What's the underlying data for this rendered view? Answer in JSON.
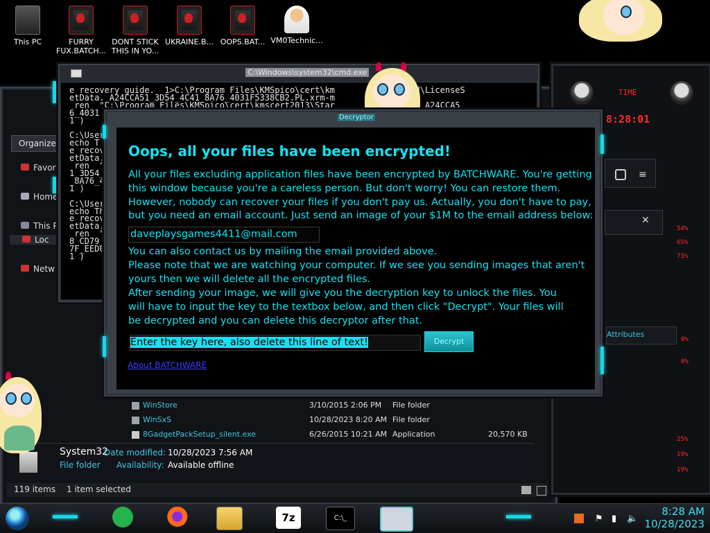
{
  "desktop": {
    "icons": [
      {
        "label": "This PC",
        "icon": "computer-icon"
      },
      {
        "label": "FURRY FUX.BATCH...",
        "icon": "alienware-bat-icon"
      },
      {
        "label": "DONT STICK THIS IN YO...",
        "icon": "alienware-bat-icon"
      },
      {
        "label": "UKRAINE.B...",
        "icon": "alienware-bat-icon"
      },
      {
        "label": "OOPS.BAT...",
        "icon": "alienware-bat-icon"
      },
      {
        "label": "VM0Technic...",
        "icon": "doctor-avatar-icon"
      }
    ]
  },
  "cmd": {
    "title": "C:\\Windows\\system32\\cmd.exe",
    "lines": [
      "e recovery guide.  1>C:\\Program Files\\KMSpico\\cert\\km         Standard\\LicenseS",
      "etData._A24CCA51_3D54_4C41_8A76_4031F5338CB2.PL.xrm-m",
      " ren  \"C:\\Program Files\\KMSpico\\cert\\kmscert2013\\Star      nseSetData._A24CCA5",
      "6_4031",
      "1 )",
      "",
      "C:\\User",
      "echo T",
      "e recov",
      "etData.",
      " ren  \"",
      "1_3D54_",
      "_8A76_4",
      "1 )",
      "",
      "C:\\User",
      "echo Th",
      "e recov",
      "etData.",
      " ren  \"C",
      "8_CD79_",
      "7F_EED0",
      "1 )"
    ]
  },
  "explorer": {
    "organize_label": "Organize",
    "sidebar": [
      "Favor",
      "Home",
      "This P",
      "Loc",
      "Netw"
    ],
    "files": [
      {
        "name": "WinStore",
        "date": "3/10/2015 2:06 PM",
        "type": "File folder",
        "size": ""
      },
      {
        "name": "WinSxS",
        "date": "10/28/2023 8:20 AM",
        "type": "File folder",
        "size": ""
      },
      {
        "name": "8GadgetPackSetup_silent.exe",
        "date": "6/26/2015 10:21 AM",
        "type": "Application",
        "size": "20,570 KB"
      }
    ],
    "detail": {
      "name": "System32",
      "type": "File folder",
      "date_label": "Date modified:",
      "date_value": "10/28/2023 7:56 AM",
      "avail_label": "Availability:",
      "avail_value": "Available offline"
    },
    "status": {
      "items": "119 items",
      "selected": "1 item selected"
    },
    "attributes_label": "Attributes"
  },
  "gadget": {
    "time_label": "TIME",
    "time_value": "8:28:01",
    "percents": [
      "54%",
      "65%",
      "73%",
      "0%",
      "0%",
      "25%",
      "19%",
      "19%"
    ]
  },
  "dialog": {
    "title": "Decryptor",
    "headline": "Oops, all your files have been encrypted!",
    "para1": "All your files excluding application files have been encrypted by BATCHWARE. You're getting this window because you're a careless person. But don't worry! You can restore them. However, nobody can recover your files if you don't pay us. Actually, you don't have to pay, but you need an email account. Just send an image of your $1M to the email address below:",
    "email": "daveplaysgames4411@mail.com",
    "para2": "You can also contact us by mailing the email provided above.",
    "para3": "Please note that we are watching your computer. If we see you sending images that aren't yours then we will delete all the encrypted files.",
    "para4": "After sending your image, we will give you the decryption key to unlock the files. You will have to input the key to the textbox below, and then click \"Decrypt\". Your files will be decrypted and you can delete this decryptor after that.",
    "key_placeholder": "Enter the key here, also delete this line of text!",
    "decrypt_label": "Decrypt",
    "about_label": "About BATCHWARE"
  },
  "taskbar": {
    "apps": [
      "start-orb-icon",
      "chat-icon",
      "firefox-icon",
      "file-explorer-icon",
      "7zip-icon",
      "cmd-icon",
      "window-icon"
    ],
    "time": "8:28 AM",
    "date": "10/28/2023"
  },
  "colors": {
    "accent": "#12e3f4",
    "link": "#3b3bff",
    "alert_red": "#ff2a2a"
  }
}
